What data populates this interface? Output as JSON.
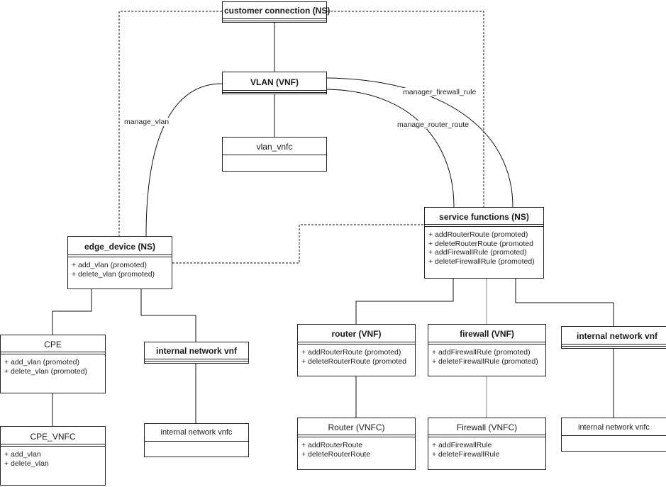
{
  "diagram": {
    "type": "uml-class-diagram",
    "classes": {
      "customer_connection": {
        "name": "customer connection (NS)",
        "operations": []
      },
      "vlan_vnf": {
        "name": "VLAN (VNF)",
        "operations": []
      },
      "vlan_vnfc": {
        "name": "vlan_vnfc",
        "operations": []
      },
      "edge_device": {
        "name": "edge_device (NS)",
        "operations": [
          "+ add_vlan (promoted)",
          "+ delete_vlan (promoted)"
        ]
      },
      "service_functions": {
        "name": "service functions (NS)",
        "operations": [
          "+ addRouterRoute (promoted)",
          "+ deleteRouterRoute (promoted",
          "+ addFirewallRule (promoted)",
          "+ deleteFirewallRule (promoted)"
        ]
      },
      "cpe": {
        "name": "CPE",
        "operations": [
          "+ add_vlan (promoted)",
          "+ delete_vlan (promoted)"
        ]
      },
      "cpe_vnfc": {
        "name": "CPE_VNFC",
        "operations": [
          "+ add_vlan",
          "+ delete_vlan"
        ]
      },
      "internal_vnf_left": {
        "name": "internal network vnf",
        "operations": []
      },
      "internal_vnfc_left": {
        "name": "internal network vnfc",
        "operations": []
      },
      "router_vnf": {
        "name": "router (VNF)",
        "operations": [
          "+ addRouterRoute (promoted)",
          "+ deleteRouterRoute (promoted"
        ]
      },
      "firewall_vnf": {
        "name": "firewall (VNF)",
        "operations": [
          "+ addFirewallRule (promoted)",
          "+ deleteFirewallRule (promoted)"
        ]
      },
      "internal_vnf_right": {
        "name": "internal network vnf",
        "operations": []
      },
      "router_vnfc": {
        "name": "Router (VNFC)",
        "operations": [
          "+ addRouterRoute",
          "+ deleteRouterRoute"
        ]
      },
      "firewall_vnfc": {
        "name": "Firewall (VNFC)",
        "operations": [
          "+ addFirewallRule",
          "+ deleteFirewallRule"
        ]
      },
      "internal_vnfc_right": {
        "name": "internal network vnfc",
        "operations": []
      }
    },
    "associations": [
      {
        "label": "manage_vlan",
        "from": "VLAN (VNF)",
        "to": "edge_device (NS)"
      },
      {
        "label": "manage_router_route",
        "from": "VLAN (VNF)",
        "to": "service functions (NS)"
      },
      {
        "label": "manager_firewall_rule",
        "from": "VLAN (VNF)",
        "to": "service functions (NS)"
      }
    ],
    "compositions": [
      [
        "customer connection (NS)",
        "VLAN (VNF)"
      ],
      [
        "VLAN (VNF)",
        "vlan_vnfc"
      ],
      [
        "edge_device (NS)",
        "CPE"
      ],
      [
        "edge_device (NS)",
        "internal network vnf"
      ],
      [
        "CPE",
        "CPE_VNFC"
      ],
      [
        "internal network vnf",
        "internal network vnfc"
      ],
      [
        "service functions (NS)",
        "router (VNF)"
      ],
      [
        "service functions (NS)",
        "firewall (VNF)"
      ],
      [
        "service functions (NS)",
        "internal network vnf"
      ],
      [
        "router (VNF)",
        "Router (VNFC)"
      ],
      [
        "firewall (VNF)",
        "Firewall (VNFC)"
      ],
      [
        "internal network vnf",
        "internal network vnfc"
      ]
    ],
    "dependencies": [
      [
        "customer connection (NS)",
        "edge_device (NS)"
      ],
      [
        "customer connection (NS)",
        "service functions (NS)"
      ],
      [
        "edge_device (NS)",
        "service functions (NS)"
      ]
    ]
  }
}
